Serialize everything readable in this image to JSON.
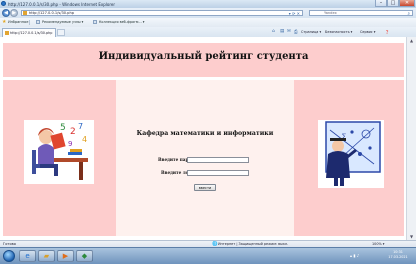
{
  "window": {
    "title": "http://127.0.0.1/s/30.php - Windows Internet Explorer"
  },
  "address_bar": {
    "url": "http://127.0.0.1/s/30.php",
    "search_placeholder": "Yandex"
  },
  "favorites_bar": {
    "label": "Избранное",
    "items": [
      "Рекомендуемые узлы ▾",
      "Коллекция веб-фрагм... ▾"
    ]
  },
  "tab": {
    "title": "http://127.0.0.1/s/30.php"
  },
  "command_bar": {
    "page": "Страница ▾",
    "safety": "Безопасность ▾",
    "tools": "Сервис ▾",
    "help": "❓"
  },
  "page": {
    "title": "Индивидуальный рейтинг студента",
    "department": "Кафедра математики и информатики",
    "password_label": "Введите пароль",
    "login_label": "Введите логин",
    "submit_label": "ввести",
    "colors": {
      "band": "#fdcdcd",
      "center": "#fef1ee"
    }
  },
  "status_bar": {
    "status": "Готово",
    "zone": "Интернет | Защищенный режим: выкл.",
    "zoom": "100% ▾"
  },
  "taskbar": {
    "time": "10:31",
    "date": "17.03.2021"
  },
  "icons": {
    "left_clipart": "student-with-books-illustration",
    "right_clipart": "professor-at-blackboard-illustration"
  }
}
